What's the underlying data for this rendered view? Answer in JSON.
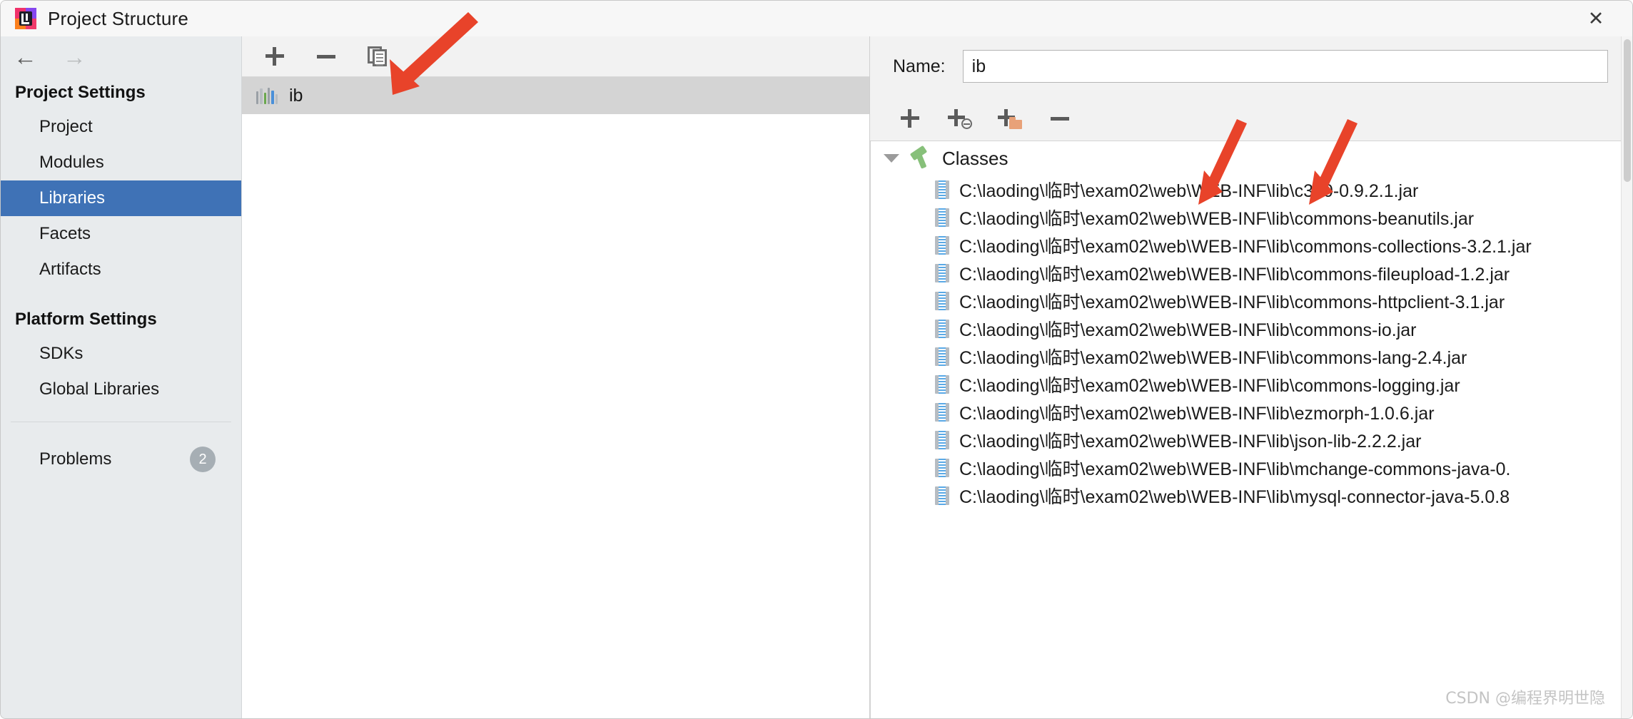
{
  "window": {
    "title": "Project Structure",
    "close_label": "✕",
    "app_icon": "intellij-idea-icon"
  },
  "sidebar": {
    "nav": {
      "back": "←",
      "forward": "→"
    },
    "groups": [
      {
        "title": "Project Settings",
        "items": [
          {
            "label": "Project",
            "selected": false
          },
          {
            "label": "Modules",
            "selected": false
          },
          {
            "label": "Libraries",
            "selected": true
          },
          {
            "label": "Facets",
            "selected": false
          },
          {
            "label": "Artifacts",
            "selected": false
          }
        ]
      },
      {
        "title": "Platform Settings",
        "items": [
          {
            "label": "SDKs",
            "selected": false
          },
          {
            "label": "Global Libraries",
            "selected": false
          }
        ]
      }
    ],
    "problems": {
      "label": "Problems",
      "count": "2"
    },
    "selected_color": "#3f72b6"
  },
  "middle_panel": {
    "toolbar": [
      {
        "name": "add-library-button",
        "icon": "plus-icon"
      },
      {
        "name": "remove-library-button",
        "icon": "minus-icon"
      },
      {
        "name": "copy-library-button",
        "icon": "copy-icon"
      }
    ],
    "libraries": [
      {
        "label": "ib",
        "icon": "library-icon",
        "selected": true
      }
    ]
  },
  "right_panel": {
    "name_label": "Name:",
    "name_value": "ib",
    "name_placeholder": "",
    "toolbar": [
      {
        "name": "add-entry-button",
        "icon": "plus-icon"
      },
      {
        "name": "add-from-maven-button",
        "icon": "plus-globe-icon"
      },
      {
        "name": "add-from-directory-button",
        "icon": "plus-folder-icon"
      },
      {
        "name": "remove-entry-button",
        "icon": "minus-icon"
      }
    ],
    "tree": {
      "root_label": "Classes",
      "root_icon": "hammer-icon",
      "expanded": true,
      "entries": [
        "C:\\laoding\\临时\\exam02\\web\\WEB-INF\\lib\\c3p0-0.9.2.1.jar",
        "C:\\laoding\\临时\\exam02\\web\\WEB-INF\\lib\\commons-beanutils.jar",
        "C:\\laoding\\临时\\exam02\\web\\WEB-INF\\lib\\commons-collections-3.2.1.jar",
        "C:\\laoding\\临时\\exam02\\web\\WEB-INF\\lib\\commons-fileupload-1.2.jar",
        "C:\\laoding\\临时\\exam02\\web\\WEB-INF\\lib\\commons-httpclient-3.1.jar",
        "C:\\laoding\\临时\\exam02\\web\\WEB-INF\\lib\\commons-io.jar",
        "C:\\laoding\\临时\\exam02\\web\\WEB-INF\\lib\\commons-lang-2.4.jar",
        "C:\\laoding\\临时\\exam02\\web\\WEB-INF\\lib\\commons-logging.jar",
        "C:\\laoding\\临时\\exam02\\web\\WEB-INF\\lib\\ezmorph-1.0.6.jar",
        "C:\\laoding\\临时\\exam02\\web\\WEB-INF\\lib\\json-lib-2.2.2.jar",
        "C:\\laoding\\临时\\exam02\\web\\WEB-INF\\lib\\mchange-commons-java-0.",
        "C:\\laoding\\临时\\exam02\\web\\WEB-INF\\lib\\mysql-connector-java-5.0.8"
      ]
    }
  },
  "annotations": {
    "arrow_color": "#e8432a",
    "arrows": [
      {
        "name": "arrow-to-library-row"
      },
      {
        "name": "arrow-to-jar-path-left"
      },
      {
        "name": "arrow-to-jar-path-right"
      }
    ]
  },
  "watermark": "CSDN @编程界明世隐"
}
